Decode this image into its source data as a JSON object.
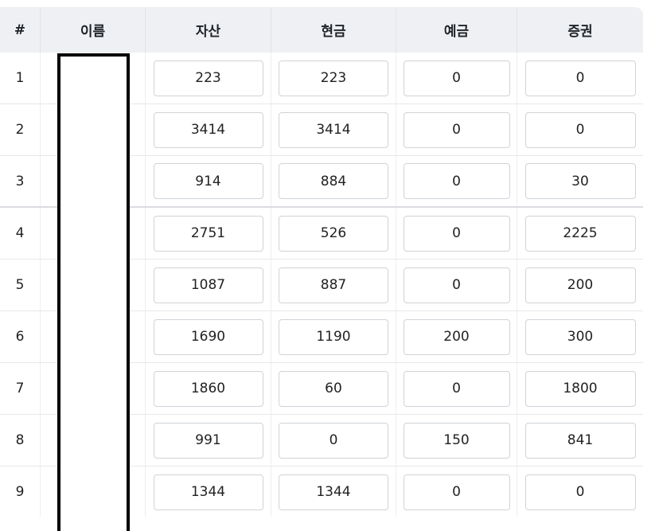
{
  "table": {
    "headers": {
      "index": "#",
      "name": "이름",
      "asset": "자산",
      "cash": "현금",
      "deposit": "예금",
      "securities": "증권"
    },
    "rows": [
      {
        "index": "1",
        "asset": "223",
        "cash": "223",
        "deposit": "0",
        "securities": "0"
      },
      {
        "index": "2",
        "asset": "3414",
        "cash": "3414",
        "deposit": "0",
        "securities": "0"
      },
      {
        "index": "3",
        "asset": "914",
        "cash": "884",
        "deposit": "0",
        "securities": "30"
      },
      {
        "index": "4",
        "asset": "2751",
        "cash": "526",
        "deposit": "0",
        "securities": "2225"
      },
      {
        "index": "5",
        "asset": "1087",
        "cash": "887",
        "deposit": "0",
        "securities": "200"
      },
      {
        "index": "6",
        "asset": "1690",
        "cash": "1190",
        "deposit": "200",
        "securities": "300"
      },
      {
        "index": "7",
        "asset": "1860",
        "cash": "60",
        "deposit": "0",
        "securities": "1800"
      },
      {
        "index": "8",
        "asset": "991",
        "cash": "0",
        "deposit": "150",
        "securities": "841"
      },
      {
        "index": "9",
        "asset": "1344",
        "cash": "1344",
        "deposit": "0",
        "securities": "0"
      }
    ]
  }
}
